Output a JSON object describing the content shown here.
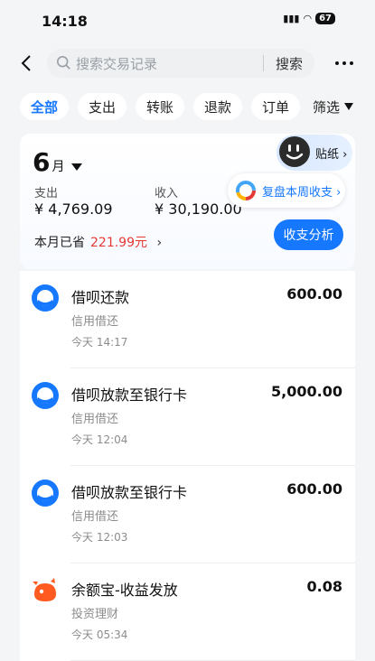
{
  "status": {
    "time": "14:18",
    "battery": "67"
  },
  "header": {
    "search_placeholder": "搜索交易记录",
    "search_button": "搜索"
  },
  "tabs": [
    {
      "label": "全部",
      "active": true
    },
    {
      "label": "支出"
    },
    {
      "label": "转账"
    },
    {
      "label": "退款"
    },
    {
      "label": "订单"
    }
  ],
  "filter_label": "筛选",
  "summary": {
    "month_number": "6",
    "month_suffix": "月",
    "expense_label": "支出",
    "expense_value": "¥ 4,769.09",
    "income_label": "收入",
    "income_value": "¥ 30,190.00",
    "saved_label": "本月已省",
    "saved_value": "221.99元",
    "sticker_label": "贴纸",
    "weekly_label": "复盘本周收支",
    "analysis_button": "收支分析"
  },
  "transactions": [
    {
      "title": "借呗还款",
      "category": "信用借还",
      "time": "今天 14:17",
      "amount": "600.00",
      "icon": "jiebei-icon"
    },
    {
      "title": "借呗放款至银行卡",
      "category": "信用借还",
      "time": "今天 12:04",
      "amount": "5,000.00",
      "icon": "jiebei-icon"
    },
    {
      "title": "借呗放款至银行卡",
      "category": "信用借还",
      "time": "今天 12:03",
      "amount": "600.00",
      "icon": "jiebei-icon"
    },
    {
      "title": "余额宝-收益发放",
      "category": "投资理财",
      "time": "今天 05:34",
      "amount": "0.08",
      "icon": "yuebao-icon"
    }
  ],
  "colors": {
    "accent": "#1677ff",
    "saved": "#e53935"
  }
}
